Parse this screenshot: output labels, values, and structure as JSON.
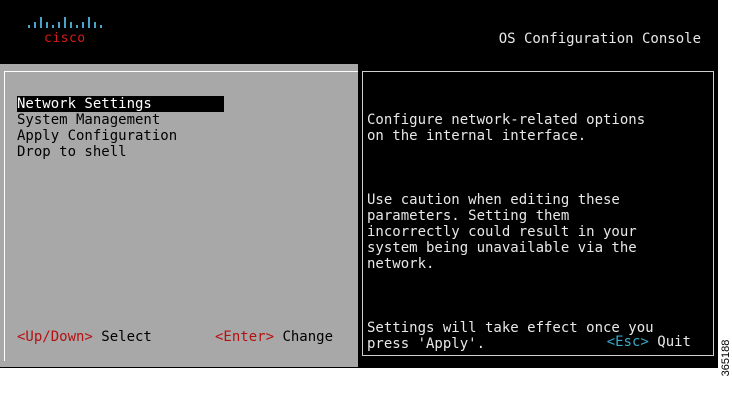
{
  "header": {
    "logo_text": "cisco",
    "console_title": "OS Configuration Console"
  },
  "menu": {
    "items": [
      {
        "label": "Network Settings",
        "selected": true
      },
      {
        "label": "System Management",
        "selected": false
      },
      {
        "label": "Apply Configuration",
        "selected": false
      },
      {
        "label": "Drop to shell",
        "selected": false
      }
    ]
  },
  "left_hints": {
    "select_key": "<Up/Down>",
    "select_action": " Select",
    "change_key": "<Enter>",
    "change_action": " Change"
  },
  "help": {
    "paragraphs": [
      "Configure network-related options\non the internal interface.",
      "Use caution when editing these\nparameters. Setting them\nincorrectly could result in your\nsystem being unavailable via the\nnetwork.",
      "Settings will take effect once you\npress 'Apply'."
    ]
  },
  "right_hints": {
    "quit_key": "<Esc>",
    "quit_action": " Quit"
  },
  "figure_number": "365188",
  "colors": {
    "screen_bg": "#000000",
    "panel_bg": "#a8a8a8",
    "key_red": "#b51010",
    "key_cyan": "#3aa7c8",
    "logo_red": "#d81c1c"
  }
}
